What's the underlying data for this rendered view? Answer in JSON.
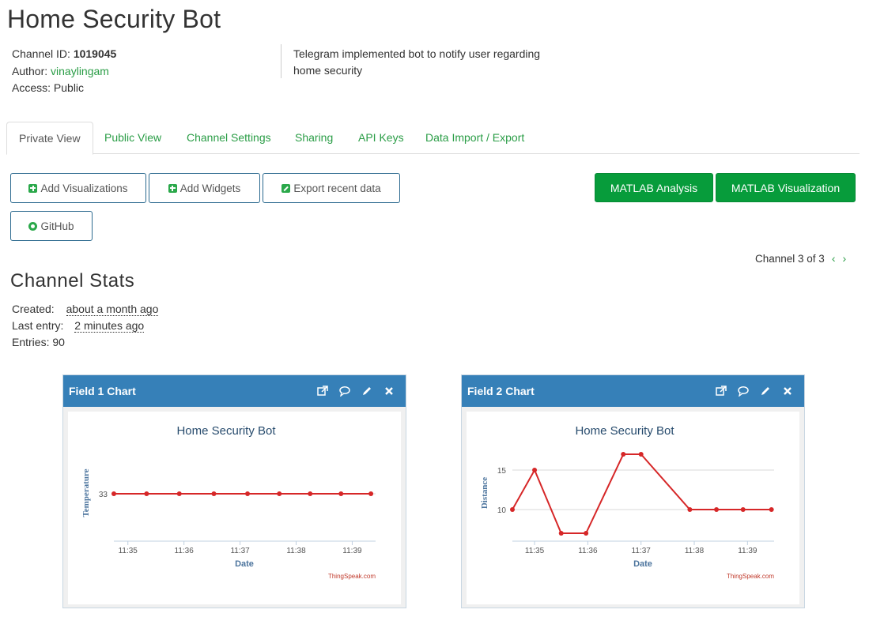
{
  "page": {
    "title": "Home Security Bot"
  },
  "channel": {
    "id_label": "Channel ID:",
    "id_value": "1019045",
    "author_label": "Author:",
    "author_value": "vinaylingam",
    "access_label": "Access:",
    "access_value": "Public",
    "description": "Telegram implemented bot to notify user regarding home security"
  },
  "tabs": [
    {
      "label": "Private View",
      "active": true
    },
    {
      "label": "Public View"
    },
    {
      "label": "Channel Settings"
    },
    {
      "label": "Sharing"
    },
    {
      "label": "API Keys"
    },
    {
      "label": "Data Import / Export"
    }
  ],
  "buttons": {
    "add_visualizations": "Add Visualizations",
    "add_widgets": "Add Widgets",
    "export_recent": "Export recent data",
    "github": "GitHub",
    "matlab_analysis": "MATLAB Analysis",
    "matlab_visualization": "MATLAB Visualization"
  },
  "pager": {
    "text": "Channel 3 of 3",
    "prev": "‹",
    "next": "›"
  },
  "stats": {
    "title": "Channel Stats",
    "created_label": "Created:",
    "created_value": "about a month ago",
    "last_entry_label": "Last entry:",
    "last_entry_value": "2 minutes ago",
    "entries_label": "Entries:",
    "entries_value": "90"
  },
  "colors": {
    "brand_green": "#2a9d46",
    "panel_header": "#3680b8",
    "line": "#d62728",
    "button_green": "#079c3b"
  },
  "icons": [
    "popout-icon",
    "comment-icon",
    "pencil-icon",
    "close-icon"
  ],
  "panels": [
    {
      "header": "Field 1 Chart"
    },
    {
      "header": "Field 2 Chart"
    }
  ],
  "chart_data": [
    {
      "type": "line",
      "title": "Home Security Bot",
      "xlabel": "Date",
      "ylabel": "Temperature",
      "credit": "ThingSpeak.com",
      "x_ticks": [
        "11:35",
        "11:36",
        "11:37",
        "11:38",
        "11:39"
      ],
      "y_ticks": [
        33
      ],
      "xlim": [
        "11:34:45",
        "11:39:25"
      ],
      "ylim": [
        23,
        43
      ],
      "grid": true,
      "series": [
        {
          "x": [
            "11:34:45",
            "11:35:20",
            "11:35:55",
            "11:36:32",
            "11:37:08",
            "11:37:42",
            "11:38:15",
            "11:38:48",
            "11:39:20"
          ],
          "y": [
            33,
            33,
            33,
            33,
            33,
            33,
            33,
            33,
            33
          ]
        }
      ]
    },
    {
      "type": "line",
      "title": "Home Security Bot",
      "xlabel": "Date",
      "ylabel": "Distance",
      "credit": "ThingSpeak.com",
      "x_ticks": [
        "11:35",
        "11:36",
        "11:37",
        "11:38",
        "11:39"
      ],
      "y_ticks": [
        10,
        15
      ],
      "xlim": [
        "11:34:35",
        "11:39:30"
      ],
      "ylim": [
        6,
        18
      ],
      "grid": true,
      "series": [
        {
          "x": [
            "11:34:35",
            "11:35:00",
            "11:35:30",
            "11:35:58",
            "11:36:40",
            "11:37:00",
            "11:37:55",
            "11:38:25",
            "11:38:55",
            "11:39:27"
          ],
          "y": [
            10,
            15,
            7,
            7,
            17,
            17,
            10,
            10,
            10,
            10
          ]
        }
      ]
    }
  ]
}
